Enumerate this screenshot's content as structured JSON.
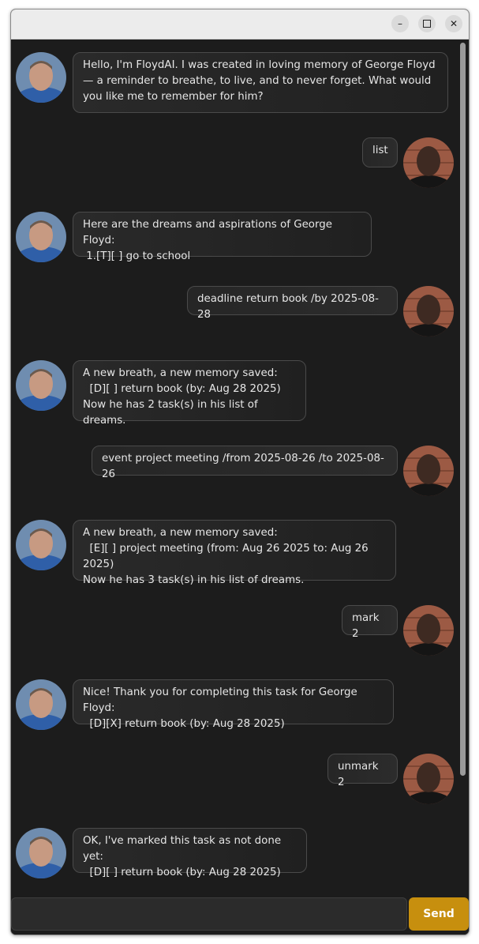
{
  "window": {
    "controls": {
      "minimize": "–",
      "close": "✕"
    }
  },
  "messages": [
    {
      "sender": "bot",
      "avatar": "floydai-avatar",
      "text": "Hello, I'm FloydAI. I was created in loving memory of George Floyd\n— a reminder to breathe, to live, and to never forget. What would\nyou like me to remember for him?"
    },
    {
      "sender": "user",
      "avatar": "user-avatar",
      "text": "list"
    },
    {
      "sender": "bot",
      "avatar": "floydai-avatar",
      "text": "Here are the dreams and aspirations of George Floyd:\n 1.[T][ ] go to school"
    },
    {
      "sender": "user",
      "avatar": "user-avatar",
      "text": "deadline return book /by 2025-08-28"
    },
    {
      "sender": "bot",
      "avatar": "floydai-avatar",
      "text": "A new breath, a new memory saved:\n  [D][ ] return book (by: Aug 28 2025)\nNow he has 2 task(s) in his list of dreams."
    },
    {
      "sender": "user",
      "avatar": "user-avatar",
      "text": "event project meeting /from 2025-08-26 /to 2025-08-26"
    },
    {
      "sender": "bot",
      "avatar": "floydai-avatar",
      "text": "A new breath, a new memory saved:\n  [E][ ] project meeting (from: Aug 26 2025 to: Aug 26 2025)\nNow he has 3 task(s) in his list of dreams."
    },
    {
      "sender": "user",
      "avatar": "user-avatar",
      "text": "mark 2"
    },
    {
      "sender": "bot",
      "avatar": "floydai-avatar",
      "text": "Nice! Thank you for completing this task for George Floyd:\n  [D][X] return book (by: Aug 28 2025)"
    },
    {
      "sender": "user",
      "avatar": "user-avatar",
      "text": "unmark 2"
    },
    {
      "sender": "bot",
      "avatar": "floydai-avatar",
      "text": "OK, I've marked this task as not done yet:\n  [D][ ] return book (by: Aug 28 2025)"
    }
  ],
  "input": {
    "value": "",
    "placeholder": ""
  },
  "send_label": "Send",
  "colors": {
    "accent": "#c78f0e",
    "background": "#1c1c1c",
    "bubble_border": "#4a4a4a"
  }
}
